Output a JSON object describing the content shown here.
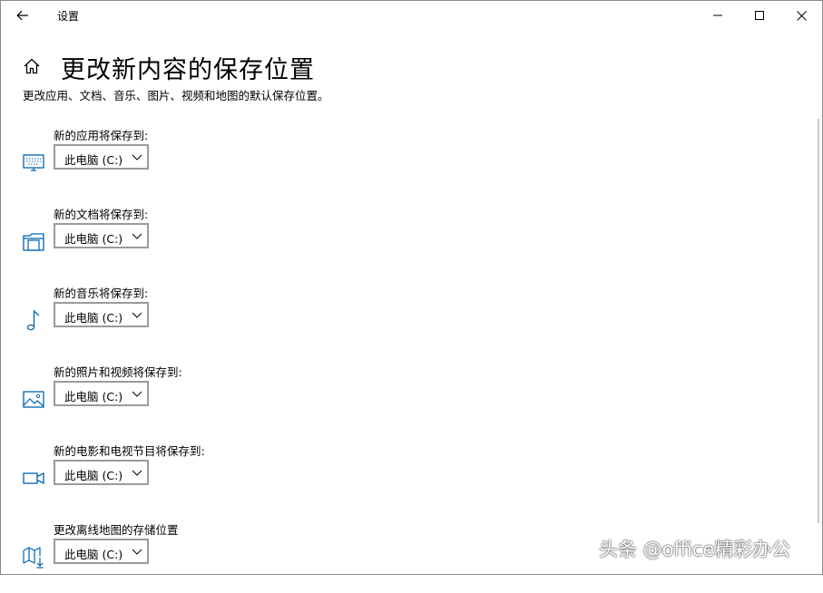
{
  "window": {
    "title": "设置"
  },
  "page": {
    "title": "更改新内容的保存位置",
    "description": "更改应用、文档、音乐、图片、视频和地图的默认保存位置。"
  },
  "settings": [
    {
      "label": "新的应用将保存到:",
      "value": "此电脑 (C:)",
      "icon": "monitor-icon"
    },
    {
      "label": "新的文档将保存到:",
      "value": "此电脑 (C:)",
      "icon": "documents-folder-icon"
    },
    {
      "label": "新的音乐将保存到:",
      "value": "此电脑 (C:)",
      "icon": "music-note-icon"
    },
    {
      "label": "新的照片和视频将保存到:",
      "value": "此电脑 (C:)",
      "icon": "picture-icon"
    },
    {
      "label": "新的电影和电视节目将保存到:",
      "value": "此电脑 (C:)",
      "icon": "video-camera-icon"
    },
    {
      "label": "更改离线地图的存储位置",
      "value": "此电脑 (C:)",
      "icon": "map-download-icon"
    }
  ],
  "watermark": "头条 @office精彩办公",
  "colors": {
    "accent": "#0063b1",
    "dropdown_border": "#9a9a9a"
  }
}
